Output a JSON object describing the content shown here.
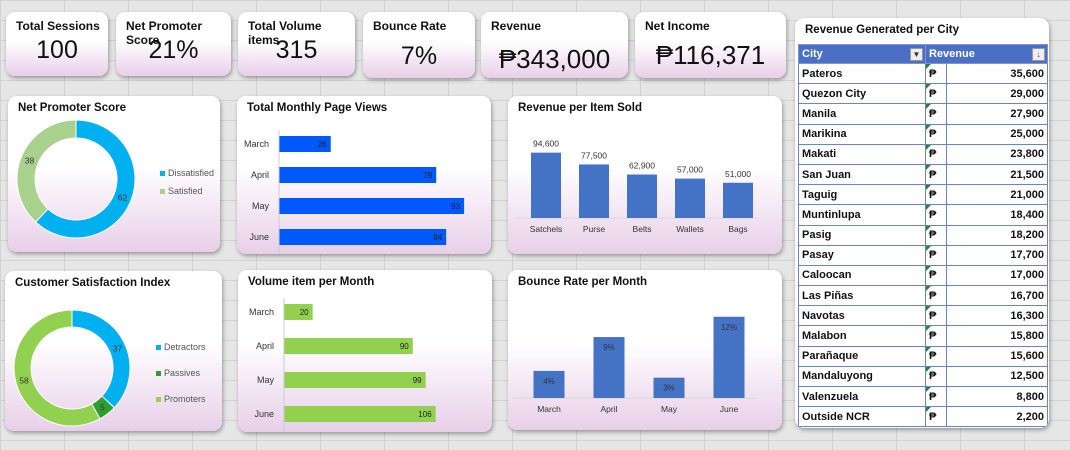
{
  "kpis": [
    {
      "title": "Total Sessions",
      "value": "100"
    },
    {
      "title": "Net Promoter Score",
      "value": "21%"
    },
    {
      "title": "Total Volume items",
      "value": "315"
    },
    {
      "title": "Bounce Rate",
      "value": "7%"
    },
    {
      "title": "Revenue",
      "value": "₱343,000"
    },
    {
      "title": "Net Income",
      "value": "₱116,371"
    }
  ],
  "panels": {
    "nps": "Net Promoter Score",
    "page_views": "Total Monthly Page Views",
    "revenue_item": "Revenue per Item Sold",
    "csi": "Customer Satisfaction Index",
    "volume": "Volume item per Month",
    "bounce": "Bounce Rate per Month",
    "city": "Revenue Generated per City"
  },
  "city_table": {
    "headers": [
      "City",
      "Revenue"
    ],
    "currency": "₱",
    "rows": [
      [
        "Pateros",
        "35,600"
      ],
      [
        "Quezon City",
        "29,000"
      ],
      [
        "Manila",
        "27,900"
      ],
      [
        "Marikina",
        "25,000"
      ],
      [
        "Makati",
        "23,800"
      ],
      [
        "San Juan",
        "21,500"
      ],
      [
        "Taguig",
        "21,000"
      ],
      [
        "Muntinlupa",
        "18,400"
      ],
      [
        "Pasig",
        "18,200"
      ],
      [
        "Pasay",
        "17,700"
      ],
      [
        "Caloocan",
        "17,000"
      ],
      [
        "Las Piñas",
        "16,700"
      ],
      [
        "Navotas",
        "16,300"
      ],
      [
        "Malabon",
        "15,800"
      ],
      [
        "Parañaque",
        "15,600"
      ],
      [
        "Mandaluyong",
        "12,500"
      ],
      [
        "Valenzuela",
        "8,800"
      ],
      [
        "Outside NCR",
        "2,200"
      ]
    ]
  },
  "chart_data": [
    {
      "id": "nps",
      "type": "pie",
      "categories": [
        "Dissatisfied",
        "Satisfied"
      ],
      "values": [
        62,
        38
      ],
      "colors": [
        "#00b0f0",
        "#a9d18e"
      ],
      "legend": "right"
    },
    {
      "id": "page_views",
      "type": "bar",
      "orientation": "horizontal",
      "categories": [
        "March",
        "April",
        "May",
        "June"
      ],
      "values": [
        26,
        79,
        93,
        84
      ],
      "xlim": [
        0,
        100
      ],
      "color": "#0059ff"
    },
    {
      "id": "revenue_item",
      "type": "bar",
      "categories": [
        "Satchels",
        "Purse",
        "Belts",
        "Wallets",
        "Bags"
      ],
      "values": [
        94600,
        77500,
        62900,
        57000,
        51000
      ],
      "labels": [
        "94,600",
        "77,500",
        "62,900",
        "57,000",
        "51,000"
      ],
      "ylim": [
        0,
        110000
      ],
      "color": "#4472c4"
    },
    {
      "id": "csi",
      "type": "pie",
      "categories": [
        "Detractors",
        "Passives",
        "Promoters"
      ],
      "values": [
        37,
        5,
        58
      ],
      "colors": [
        "#00b0f0",
        "#2e9e2e",
        "#92d050"
      ],
      "legend": "right"
    },
    {
      "id": "volume",
      "type": "bar",
      "orientation": "horizontal",
      "categories": [
        "March",
        "April",
        "May",
        "June"
      ],
      "values": [
        20,
        90,
        99,
        106
      ],
      "xlim": [
        0,
        130
      ],
      "color": "#92d050"
    },
    {
      "id": "bounce",
      "type": "bar",
      "categories": [
        "March",
        "April",
        "May",
        "June"
      ],
      "values": [
        4,
        9,
        3,
        12
      ],
      "labels": [
        "4%",
        "9%",
        "3%",
        "12%"
      ],
      "ylim": [
        0,
        13
      ],
      "color": "#4472c4"
    }
  ]
}
